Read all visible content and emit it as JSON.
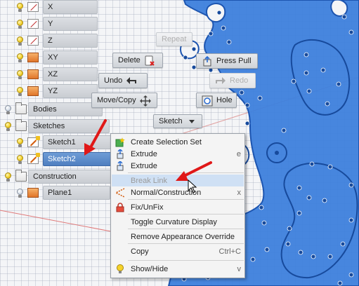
{
  "browser": {
    "items": [
      {
        "label": "X",
        "icon": "axis-icon",
        "visible": true
      },
      {
        "label": "Y",
        "icon": "axis-icon",
        "visible": true
      },
      {
        "label": "Z",
        "icon": "axis-icon",
        "visible": true
      },
      {
        "label": "XY",
        "icon": "plane-icon",
        "visible": true
      },
      {
        "label": "XZ",
        "icon": "plane-icon",
        "visible": true
      },
      {
        "label": "YZ",
        "icon": "plane-icon",
        "visible": true
      },
      {
        "label": "Bodies",
        "icon": "folder-icon",
        "visible": false
      },
      {
        "label": "Sketches",
        "icon": "folder-icon",
        "visible": true
      },
      {
        "label": "Sketch1",
        "icon": "sketch-icon",
        "visible": true
      },
      {
        "label": "Sketch2",
        "icon": "sketch-icon",
        "visible": true,
        "selected": true
      },
      {
        "label": "Construction",
        "icon": "folder-icon",
        "visible": true
      },
      {
        "label": "Plane1",
        "icon": "plane-icon",
        "visible": false
      }
    ]
  },
  "marking_menu": {
    "repeat": "Repeat",
    "delete": "Delete",
    "press_pull": "Press Pull",
    "undo": "Undo",
    "redo": "Redo",
    "move_copy": "Move/Copy",
    "hole": "Hole",
    "sketch": "Sketch"
  },
  "context_menu": {
    "items": [
      {
        "label": "Create Selection Set",
        "shortcut": "",
        "icon": "selection-set-icon"
      },
      {
        "label": "Extrude",
        "shortcut": "e",
        "icon": "extrude-icon"
      },
      {
        "label": "Extrude",
        "shortcut": "",
        "icon": "extrude-icon"
      },
      {
        "label": "Break Link",
        "shortcut": "",
        "icon": "",
        "highlighted": true,
        "disabled": true
      },
      {
        "label": "Normal/Construction",
        "shortcut": "x",
        "icon": "construction-icon"
      },
      {
        "label": "Fix/UnFix",
        "shortcut": "",
        "icon": "lock-icon"
      },
      {
        "label": "Toggle Curvature Display",
        "shortcut": "",
        "icon": ""
      },
      {
        "label": "Remove Appearance Override",
        "shortcut": "",
        "icon": ""
      },
      {
        "label": "Copy",
        "shortcut": "Ctrl+C",
        "icon": ""
      },
      {
        "label": "Show/Hide",
        "shortcut": "v",
        "icon": "lightbulb-icon"
      }
    ]
  },
  "colors": {
    "sketch_fill": "#3d7fdc",
    "sketch_line": "#1d55b0",
    "selection": "#4f7fc0",
    "annotation_arrow": "#e01818"
  }
}
